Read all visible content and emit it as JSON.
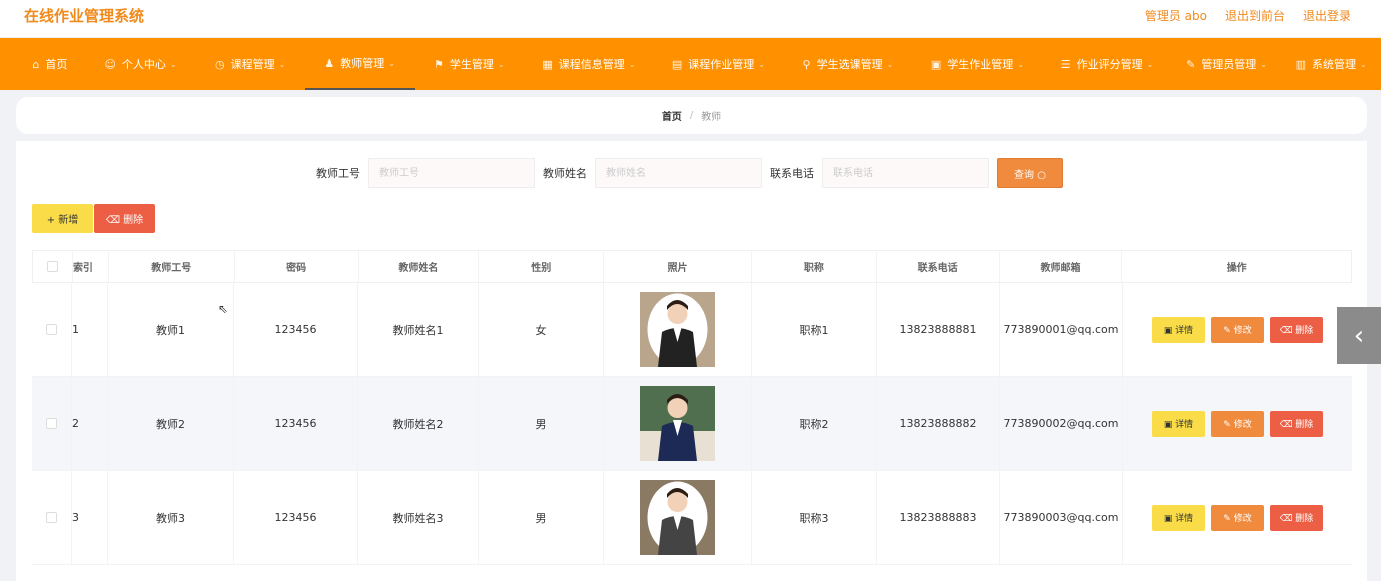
{
  "header": {
    "brand": "在线作业管理系统",
    "links": [
      "管理员 abo",
      "退出到前台",
      "退出登录"
    ]
  },
  "nav": {
    "items": [
      {
        "label": "首页",
        "icon": "home-icon",
        "glyph": "⌂"
      },
      {
        "label": "个人中心",
        "icon": "user-icon",
        "glyph": "☺"
      },
      {
        "label": "课程管理",
        "icon": "clock-icon",
        "glyph": "◷"
      },
      {
        "label": "教师管理",
        "icon": "person-icon",
        "glyph": "♟"
      },
      {
        "label": "学生管理",
        "icon": "flag-icon",
        "glyph": "⚑"
      },
      {
        "label": "课程信息管理",
        "icon": "grid-icon",
        "glyph": "▦"
      },
      {
        "label": "课程作业管理",
        "icon": "doc-icon",
        "glyph": "▤"
      },
      {
        "label": "学生选课管理",
        "icon": "pin-icon",
        "glyph": "⚲"
      },
      {
        "label": "学生作业管理",
        "icon": "briefcase-icon",
        "glyph": "▣"
      },
      {
        "label": "作业评分管理",
        "icon": "list-icon",
        "glyph": "☰"
      },
      {
        "label": "管理员管理",
        "icon": "edit-icon",
        "glyph": "✎"
      },
      {
        "label": "系统管理",
        "icon": "trash-icon",
        "glyph": "▥"
      }
    ],
    "active_index": 3
  },
  "breadcrumb": {
    "home": "首页",
    "separator": "/",
    "current": "教师"
  },
  "search": {
    "fields": [
      {
        "label": "教师工号",
        "placeholder": "教师工号"
      },
      {
        "label": "教师姓名",
        "placeholder": "教师姓名"
      },
      {
        "label": "联系电话",
        "placeholder": "联系电话"
      }
    ],
    "query_label": "查询 ○"
  },
  "toolbar": {
    "add_label": "+ 新增",
    "delete_label": "⌫ 删除"
  },
  "table": {
    "columns": [
      "",
      "索引",
      "教师工号",
      "密码",
      "教师姓名",
      "性别",
      "照片",
      "职称",
      "联系电话",
      "教师邮箱",
      "操作"
    ],
    "rows": [
      {
        "index": "1",
        "id": "教师1",
        "password": "123456",
        "name": "教师姓名1",
        "gender": "女",
        "title": "职称1",
        "phone": "13823888881",
        "email": "773890001@qq.com"
      },
      {
        "index": "2",
        "id": "教师2",
        "password": "123456",
        "name": "教师姓名2",
        "gender": "男",
        "title": "职称2",
        "phone": "13823888882",
        "email": "773890002@qq.com"
      },
      {
        "index": "3",
        "id": "教师3",
        "password": "123456",
        "name": "教师姓名3",
        "gender": "男",
        "title": "职称3",
        "phone": "13823888883",
        "email": "773890003@qq.com"
      }
    ],
    "actions": {
      "detail": "▣ 详情",
      "edit": "✎ 修改",
      "delete": "⌫ 删除"
    }
  },
  "side_tab": {
    "glyph": "‹"
  },
  "colors": {
    "brand": "#f08a1c",
    "nav_bg": "#ff9000",
    "detail": "#f9dc48",
    "edit": "#f08a3c",
    "delete": "#ec5f44"
  }
}
